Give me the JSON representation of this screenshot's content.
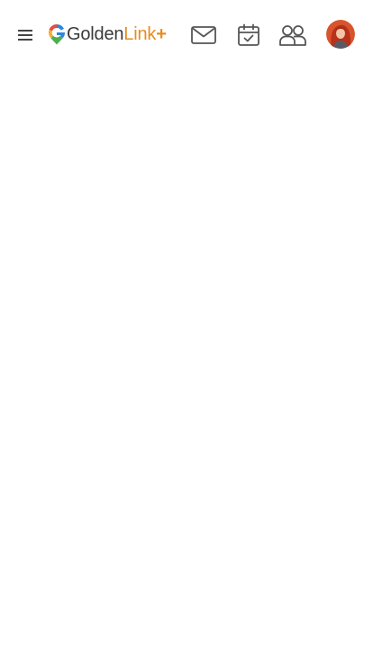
{
  "app": {
    "logo_text_part1": "Golden",
    "logo_text_part2": "Link",
    "logo_text_part3": "+"
  },
  "icons": {
    "menu": "hamburger-menu-icon",
    "mail": "mail-icon",
    "calendar": "calendar-check-icon",
    "people": "people-icon",
    "avatar": "user-avatar"
  },
  "colors": {
    "brand_dark": "#3a3a3a",
    "brand_accent": "#e98b1f",
    "icon_gray": "#555555",
    "background": "#ffffff"
  }
}
